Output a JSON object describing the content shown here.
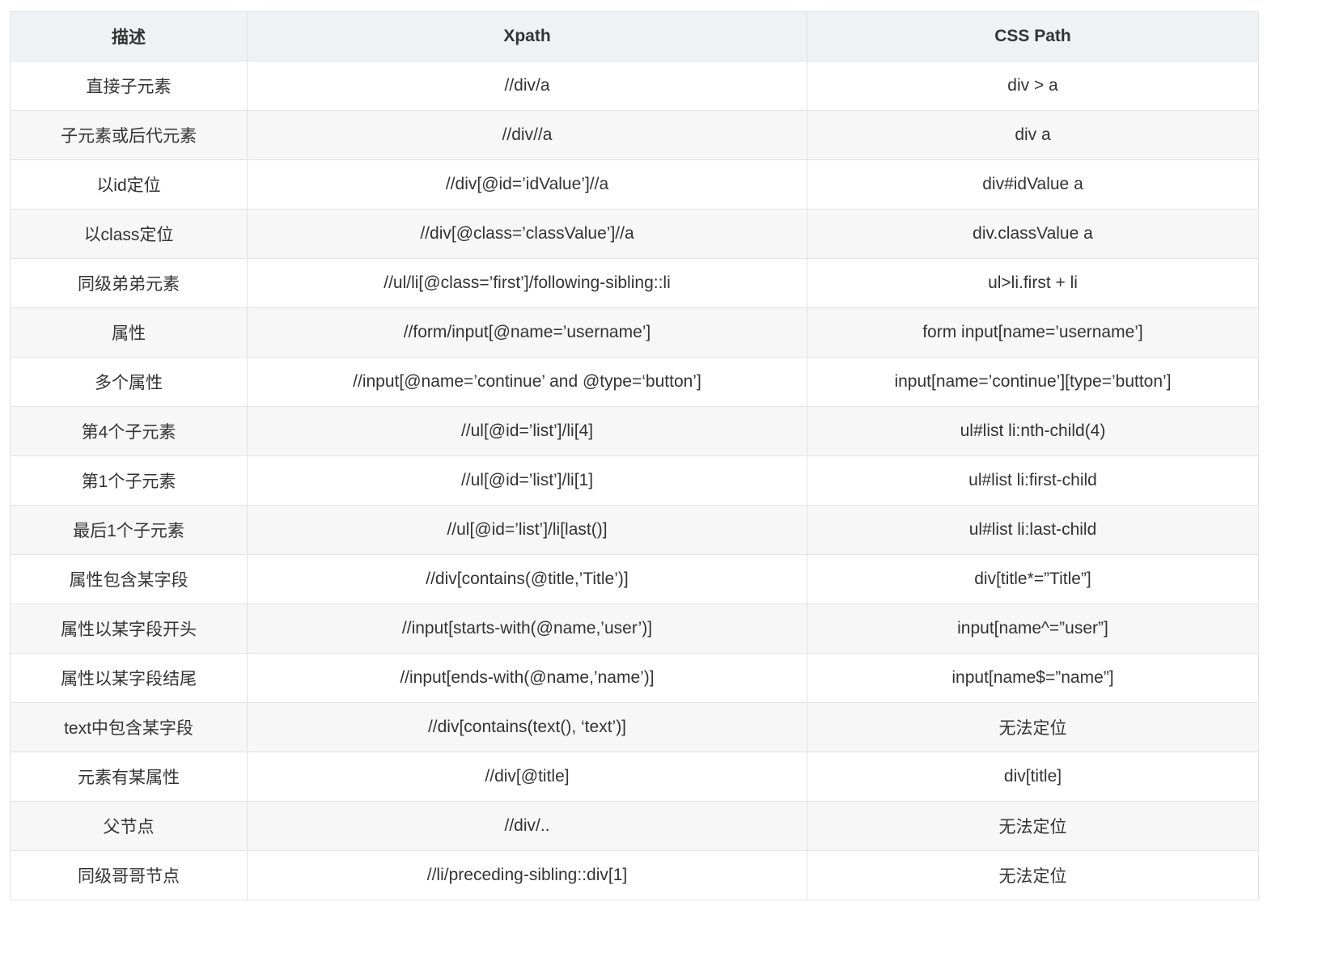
{
  "table": {
    "headers": [
      "描述",
      "Xpath",
      "CSS Path"
    ],
    "rows": [
      [
        "直接子元素",
        "//div/a",
        "div > a"
      ],
      [
        "子元素或后代元素",
        "//div//a",
        "div a"
      ],
      [
        "以id定位",
        "//div[@id=’idValue’]//a",
        "div#idValue a"
      ],
      [
        "以class定位",
        "//div[@class=’classValue’]//a",
        "div.classValue a"
      ],
      [
        "同级弟弟元素",
        "//ul/li[@class=’first’]/following-sibling::li",
        "ul>li.first + li"
      ],
      [
        "属性",
        "//form/input[@name=’username’]",
        "form input[name=’username’]"
      ],
      [
        "多个属性",
        "//input[@name=’continue’ and @type=‘button’]",
        "input[name=’continue’][type=’button’]"
      ],
      [
        "第4个子元素",
        "//ul[@id=’list’]/li[4]",
        "ul#list li:nth-child(4)"
      ],
      [
        "第1个子元素",
        "//ul[@id=’list’]/li[1]",
        "ul#list li:first-child"
      ],
      [
        "最后1个子元素",
        "//ul[@id=’list’]/li[last()]",
        "ul#list li:last-child"
      ],
      [
        "属性包含某字段",
        "//div[contains(@title,’Title’)]",
        "div[title*=”Title”]"
      ],
      [
        "属性以某字段开头",
        "//input[starts-with(@name,’user’)]",
        "input[name^=”user”]"
      ],
      [
        "属性以某字段结尾",
        "//input[ends-with(@name,’name’)]",
        "input[name$=”name”]"
      ],
      [
        "text中包含某字段",
        "//div[contains(text(), ‘text’)]",
        "无法定位"
      ],
      [
        "元素有某属性",
        "//div[@title]",
        "div[title]"
      ],
      [
        "父节点",
        "//div/..",
        "无法定位"
      ],
      [
        "同级哥哥节点",
        "//li/preceding-sibling::div[1]",
        "无法定位"
      ]
    ]
  }
}
